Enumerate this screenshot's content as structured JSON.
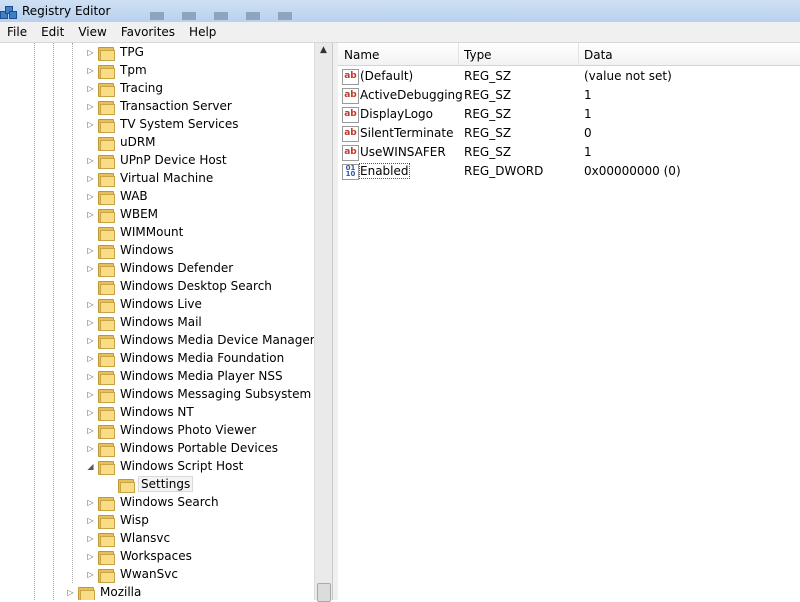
{
  "window": {
    "title": "Registry Editor"
  },
  "menu": [
    {
      "id": "file",
      "label": "File"
    },
    {
      "id": "edit",
      "label": "Edit"
    },
    {
      "id": "view",
      "label": "View"
    },
    {
      "id": "favorites",
      "label": "Favorites"
    },
    {
      "id": "help",
      "label": "Help"
    }
  ],
  "tree": {
    "items": [
      {
        "label": "TPG",
        "expander": "collapsed"
      },
      {
        "label": "Tpm",
        "expander": "collapsed"
      },
      {
        "label": "Tracing",
        "expander": "collapsed"
      },
      {
        "label": "Transaction Server",
        "expander": "collapsed"
      },
      {
        "label": "TV System Services",
        "expander": "collapsed"
      },
      {
        "label": "uDRM",
        "expander": "none"
      },
      {
        "label": "UPnP Device Host",
        "expander": "collapsed"
      },
      {
        "label": "Virtual Machine",
        "expander": "collapsed"
      },
      {
        "label": "WAB",
        "expander": "collapsed"
      },
      {
        "label": "WBEM",
        "expander": "collapsed"
      },
      {
        "label": "WIMMount",
        "expander": "none"
      },
      {
        "label": "Windows",
        "expander": "collapsed"
      },
      {
        "label": "Windows Defender",
        "expander": "collapsed"
      },
      {
        "label": "Windows Desktop Search",
        "expander": "none"
      },
      {
        "label": "Windows Live",
        "expander": "collapsed"
      },
      {
        "label": "Windows Mail",
        "expander": "collapsed"
      },
      {
        "label": "Windows Media Device Manager",
        "expander": "collapsed"
      },
      {
        "label": "Windows Media Foundation",
        "expander": "collapsed"
      },
      {
        "label": "Windows Media Player NSS",
        "expander": "collapsed"
      },
      {
        "label": "Windows Messaging Subsystem",
        "expander": "collapsed"
      },
      {
        "label": "Windows NT",
        "expander": "collapsed"
      },
      {
        "label": "Windows Photo Viewer",
        "expander": "collapsed"
      },
      {
        "label": "Windows Portable Devices",
        "expander": "collapsed"
      },
      {
        "label": "Windows Script Host",
        "expander": "expanded"
      },
      {
        "label": "Settings",
        "expander": "none",
        "child": true,
        "selected": true
      },
      {
        "label": "Windows Search",
        "expander": "collapsed"
      },
      {
        "label": "Wisp",
        "expander": "collapsed"
      },
      {
        "label": "Wlansvc",
        "expander": "collapsed"
      },
      {
        "label": "Workspaces",
        "expander": "collapsed"
      },
      {
        "label": "WwanSvc",
        "expander": "collapsed"
      },
      {
        "label": "Mozilla",
        "expander": "collapsed",
        "parent_level": true
      }
    ]
  },
  "list": {
    "columns": {
      "name": "Name",
      "type": "Type",
      "data": "Data"
    },
    "rows": [
      {
        "icon": "string-value-icon",
        "name": "(Default)",
        "type": "REG_SZ",
        "data": "(value not set)"
      },
      {
        "icon": "string-value-icon",
        "name": "ActiveDebugging",
        "type": "REG_SZ",
        "data": "1"
      },
      {
        "icon": "string-value-icon",
        "name": "DisplayLogo",
        "type": "REG_SZ",
        "data": "1"
      },
      {
        "icon": "string-value-icon",
        "name": "SilentTerminate",
        "type": "REG_SZ",
        "data": "0"
      },
      {
        "icon": "string-value-icon",
        "name": "UseWINSAFER",
        "type": "REG_SZ",
        "data": "1"
      },
      {
        "icon": "binary-value-icon",
        "name": "Enabled",
        "type": "REG_DWORD",
        "data": "0x00000000 (0)",
        "focused": true
      }
    ]
  },
  "colors": {
    "titlebar": "#c4d8f1",
    "folder": "#f8dc86",
    "string_icon": "#c0392b",
    "dword_icon": "#2a58b8"
  }
}
